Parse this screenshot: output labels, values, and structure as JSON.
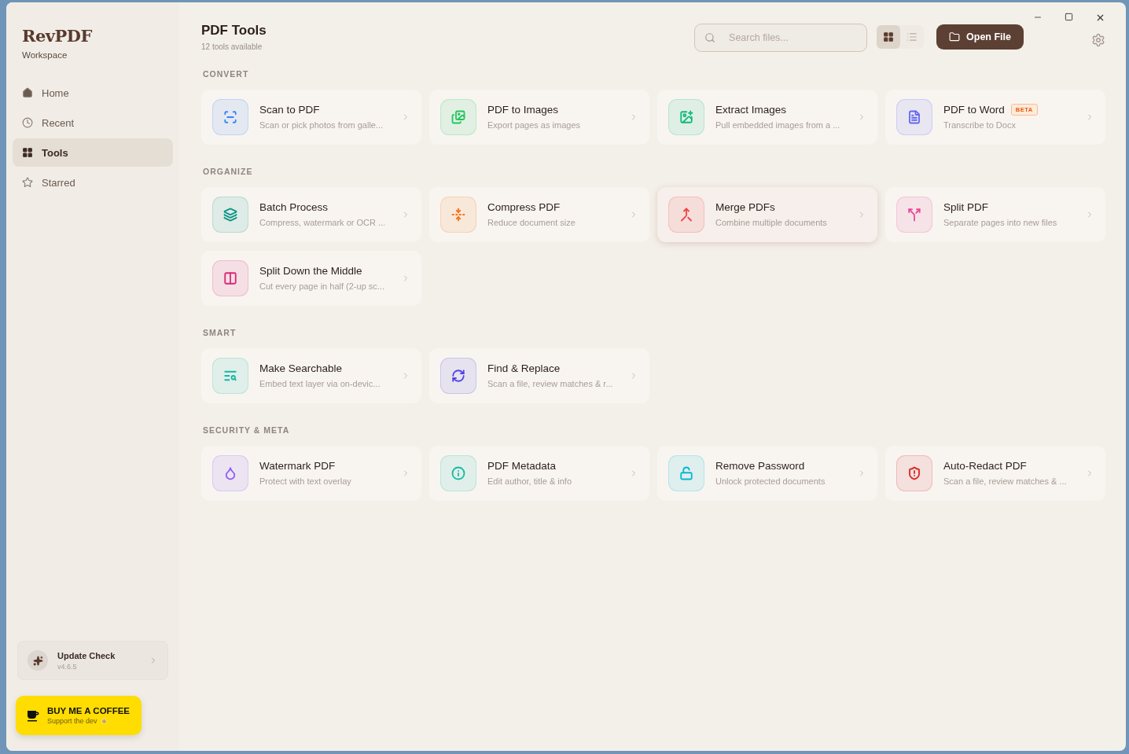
{
  "brand": {
    "name": "RevPDF",
    "subtitle": "Workspace"
  },
  "nav": [
    {
      "label": "Home",
      "selected": false
    },
    {
      "label": "Recent",
      "selected": false
    },
    {
      "label": "Tools",
      "selected": true
    },
    {
      "label": "Starred",
      "selected": false
    }
  ],
  "update": {
    "title": "Update Check",
    "version": "v4.6.5"
  },
  "coffee": {
    "title": "BUY ME A COFFEE",
    "subtitle": "Support the dev"
  },
  "header": {
    "title": "PDF Tools",
    "subtitle": "12 tools available"
  },
  "search": {
    "placeholder": "Search files..."
  },
  "view_toggle": [
    {
      "selected": true
    },
    {
      "selected": false
    }
  ],
  "open_button": "Open File",
  "sections": [
    {
      "title": "CONVERT",
      "tools": [
        {
          "title": "Scan to PDF",
          "description": "Scan or pick photos from galle...",
          "color": "#3b82f6",
          "selected": false
        },
        {
          "title": "PDF to Images",
          "description": "Export pages as images",
          "color": "#22c55e",
          "selected": false
        },
        {
          "title": "Extract Images",
          "description": "Pull embedded images from a ...",
          "color": "#10b981",
          "selected": false
        },
        {
          "title": "PDF to Word",
          "description": "Transcribe to Docx",
          "color": "#6366f1",
          "badge": "BETA",
          "selected": false
        }
      ]
    },
    {
      "title": "ORGANIZE",
      "tools": [
        {
          "title": "Batch Process",
          "description": "Compress, watermark or OCR ...",
          "color": "#0d9488",
          "selected": false
        },
        {
          "title": "Compress PDF",
          "description": "Reduce document size",
          "color": "#f97316",
          "selected": false
        },
        {
          "title": "Merge PDFs",
          "description": "Combine multiple documents",
          "color": "#ef4444",
          "selected": true
        },
        {
          "title": "Split PDF",
          "description": "Separate pages into new files",
          "color": "#ec4899",
          "selected": false
        },
        {
          "title": "Split Down the Middle",
          "description": "Cut every page in half (2-up sc...",
          "color": "#db2777",
          "selected": false
        }
      ]
    },
    {
      "title": "SMART",
      "tools": [
        {
          "title": "Make Searchable",
          "description": "Embed text layer via on-devic...",
          "color": "#14b8a6",
          "selected": false
        },
        {
          "title": "Find & Replace",
          "description": "Scan a file, review matches & r...",
          "color": "#4f46e5",
          "selected": false
        }
      ]
    },
    {
      "title": "SECURITY & META",
      "tools": [
        {
          "title": "Watermark PDF",
          "description": "Protect with text overlay",
          "color": "#8b5cf6",
          "selected": false
        },
        {
          "title": "PDF Metadata",
          "description": "Edit author, title & info",
          "color": "#14b8a6",
          "selected": false
        },
        {
          "title": "Remove Password",
          "description": "Unlock protected documents",
          "color": "#06b6d4",
          "selected": false
        },
        {
          "title": "Auto-Redact PDF",
          "description": "Scan a file, review matches & ...",
          "color": "#dc2626",
          "selected": false
        }
      ]
    }
  ]
}
